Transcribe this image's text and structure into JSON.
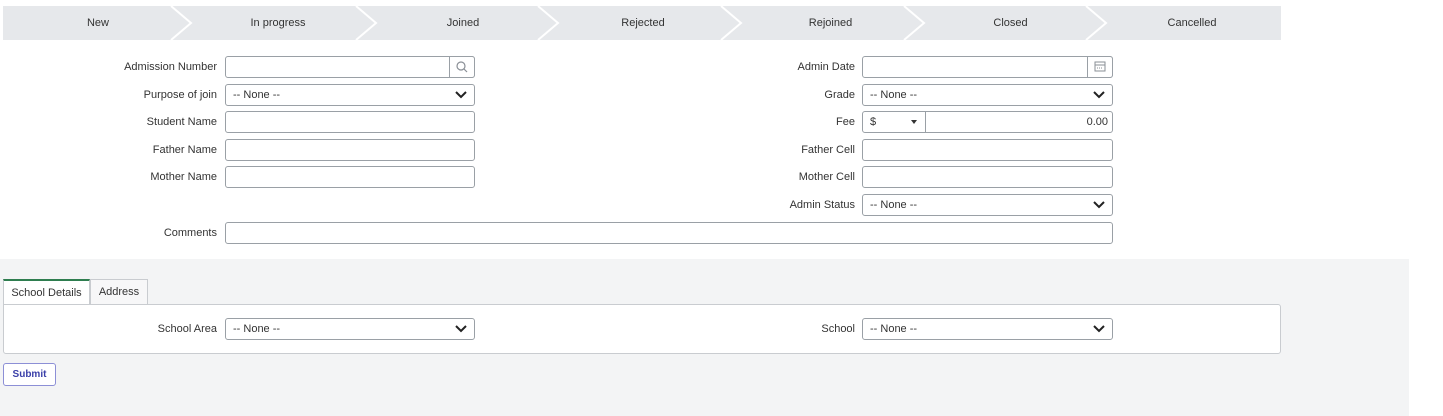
{
  "stages": [
    "New",
    "In progress",
    "Joined",
    "Rejected",
    "Rejoined",
    "Closed",
    "Cancelled"
  ],
  "form": {
    "admission_number_label": "Admission Number",
    "purpose_label": "Purpose of join",
    "purpose_value": "-- None --",
    "student_name_label": "Student Name",
    "father_name_label": "Father Name",
    "mother_name_label": "Mother Name",
    "comments_label": "Comments",
    "admin_date_label": "Admin Date",
    "grade_label": "Grade",
    "grade_value": "-- None --",
    "fee_label": "Fee",
    "fee_currency": "$",
    "fee_value": "0.00",
    "father_cell_label": "Father Cell",
    "mother_cell_label": "Mother Cell",
    "admin_status_label": "Admin Status",
    "admin_status_value": "-- None --"
  },
  "tabs": [
    "School Details",
    "Address"
  ],
  "school_details": {
    "school_area_label": "School Area",
    "school_area_value": "-- None --",
    "school_label": "School",
    "school_value": "-- None --"
  },
  "submit_label": "Submit",
  "colors": {
    "active_tab_accent": "#2e7d4f",
    "submit_text": "#3a3fa8",
    "stage_bar": "#e6e8eb"
  }
}
